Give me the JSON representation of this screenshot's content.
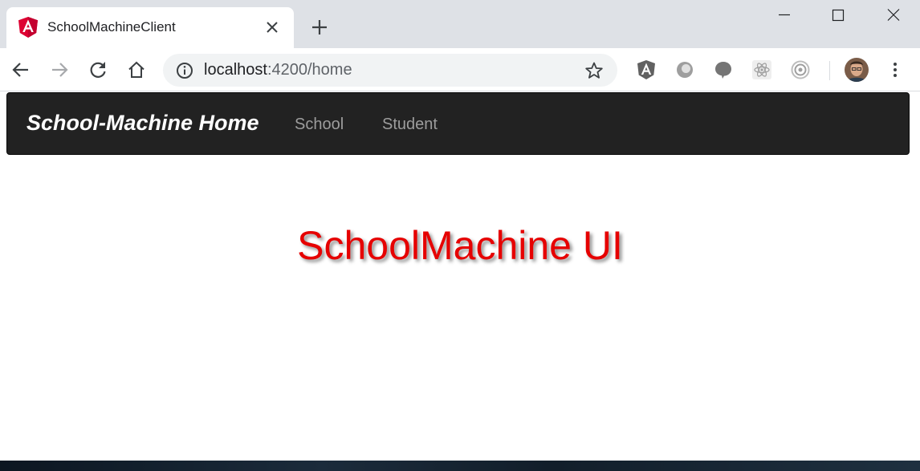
{
  "browser": {
    "tab": {
      "title": "SchoolMachineClient"
    },
    "address_bar": {
      "host": "localhost",
      "rest": ":4200/home"
    },
    "colors": {
      "frame": "#dee1e6",
      "omnibox": "#f1f3f4"
    },
    "extensions": [
      "angular-icon",
      "extension-circle-icon",
      "chat-bubble-icon",
      "react-icon",
      "target-icon"
    ]
  },
  "app": {
    "brand": "School-Machine Home",
    "nav": [
      {
        "label": "School"
      },
      {
        "label": "Student"
      }
    ],
    "heading": "SchoolMachine UI",
    "colors": {
      "navbar": "#222222",
      "heading": "#e60000",
      "nav_link": "#9d9d9d"
    }
  }
}
